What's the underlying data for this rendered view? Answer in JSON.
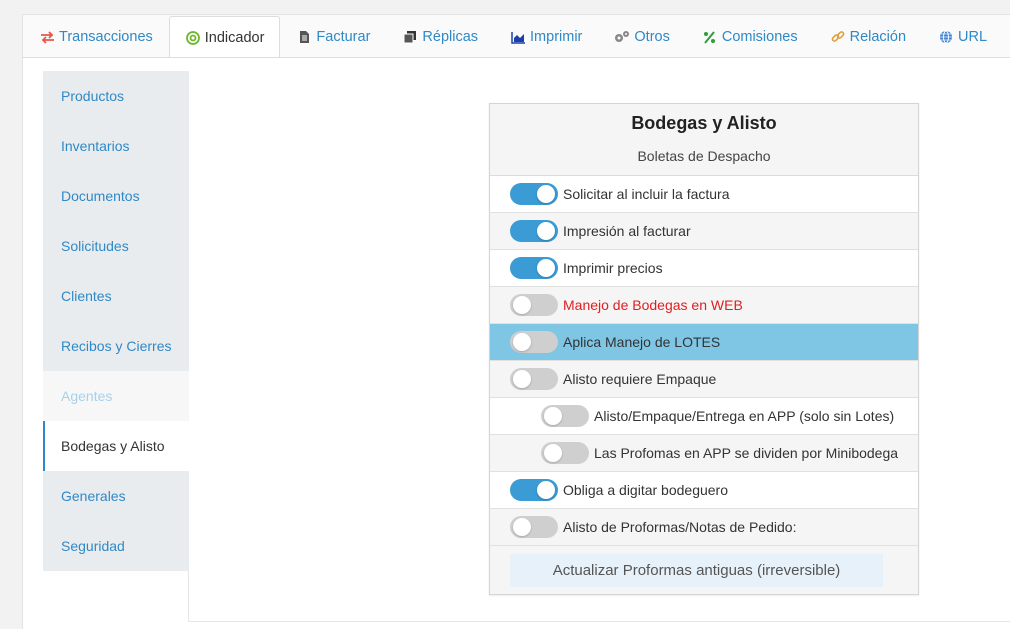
{
  "tabs": [
    {
      "label": "Transacciones",
      "icon": "exchange-icon"
    },
    {
      "label": "Indicador",
      "icon": "target-icon"
    },
    {
      "label": "Facturar",
      "icon": "document-icon"
    },
    {
      "label": "Réplicas",
      "icon": "copy-icon"
    },
    {
      "label": "Imprimir",
      "icon": "area-chart-icon"
    },
    {
      "label": "Otros",
      "icon": "gears-icon"
    },
    {
      "label": "Comisiones",
      "icon": "percent-icon"
    },
    {
      "label": "Relación",
      "icon": "link-icon"
    },
    {
      "label": "URL",
      "icon": "globe-icon"
    }
  ],
  "active_tab": "Indicador",
  "sidebar": {
    "items": [
      {
        "label": "Productos"
      },
      {
        "label": "Inventarios"
      },
      {
        "label": "Documentos"
      },
      {
        "label": "Solicitudes"
      },
      {
        "label": "Clientes"
      },
      {
        "label": "Recibos y Cierres"
      },
      {
        "label": "Agentes"
      },
      {
        "label": "Bodegas y Alisto"
      },
      {
        "label": "Generales"
      },
      {
        "label": "Seguridad"
      }
    ]
  },
  "panel": {
    "title": "Bodegas y Alisto",
    "subtitle": "Boletas de Despacho",
    "settings": [
      {
        "label": "Solicitar al incluir la factura",
        "on": true
      },
      {
        "label": "Impresión al facturar",
        "on": true
      },
      {
        "label": "Imprimir precios",
        "on": true
      },
      {
        "label": "Manejo de Bodegas en WEB",
        "on": false
      },
      {
        "label": "Aplica Manejo de LOTES",
        "on": false
      },
      {
        "label": "Alisto requiere Empaque",
        "on": false
      },
      {
        "label": "Alisto/Empaque/Entrega en APP (solo sin Lotes)",
        "on": false
      },
      {
        "label": "Las Profomas en APP se dividen por Minibodega",
        "on": false
      },
      {
        "label": "Obliga a digitar bodeguero",
        "on": true
      },
      {
        "label": "Alisto de Proformas/Notas de Pedido:",
        "on": false
      }
    ],
    "action_button": "Actualizar Proformas antiguas (irreversible)"
  },
  "colors": {
    "accent": "#2f89c6",
    "toggle_on": "#3a9bd5",
    "highlight_row": "#7fc6e4",
    "warning_text": "#e02020"
  }
}
